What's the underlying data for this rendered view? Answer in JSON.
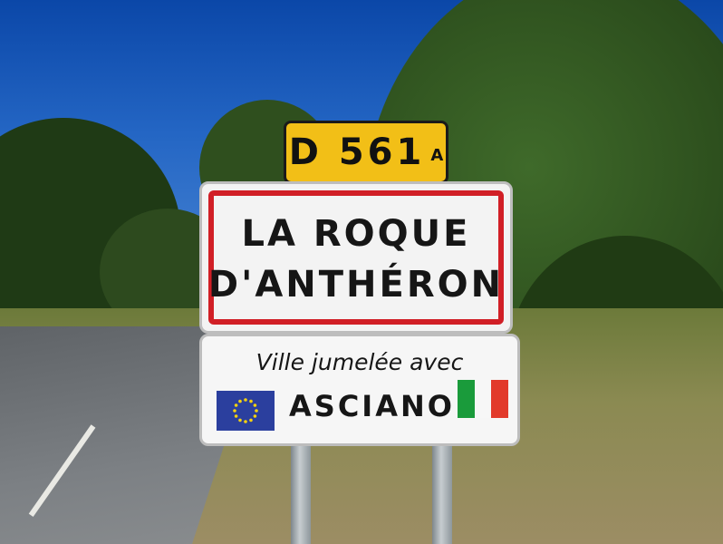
{
  "route_plate": {
    "number": "D 561",
    "suffix": "A",
    "color": "#f2bf17"
  },
  "town_plate": {
    "line1": "LA ROQUE",
    "line2": "D'ANTHÉRON",
    "border_color": "#d11f26"
  },
  "twin_plate": {
    "caption": "Ville jumelée avec",
    "city": "ASCIANO"
  },
  "flags": {
    "eu": {
      "icon": "eu-flag-icon",
      "blue": "#2b3f9e",
      "star": "#f5d20f"
    },
    "italy": {
      "icon": "italy-flag-icon",
      "colors": [
        "#1a9b3b",
        "#f7f7f7",
        "#e23a2b"
      ]
    }
  },
  "scene_colors": {
    "sky": "#0b47a8",
    "foliage": "#2e4d1c",
    "road": "#6c7074"
  }
}
